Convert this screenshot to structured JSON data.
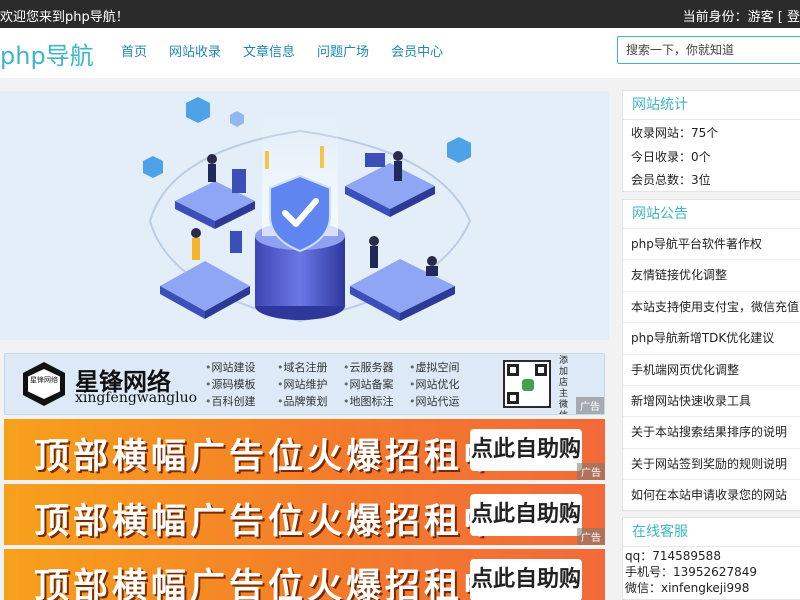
{
  "topbar": {
    "welcome": "欢迎您来到php导航！",
    "identity": "当前身份：游客 [ 登"
  },
  "header": {
    "logo": "php导航",
    "nav": [
      "首页",
      "网站收录",
      "文章信息",
      "问题广场",
      "会员中心"
    ],
    "search_placeholder": "搜索一下，你就知道"
  },
  "banner": {
    "slide_count": 2,
    "active_slide": 0
  },
  "ads": {
    "brand": {
      "name": "星锋网络",
      "pinyin": "xingfengwangluo",
      "badge": "星锋网络",
      "services": [
        "网站建设",
        "域名注册",
        "云服务器",
        "虚拟空间",
        "源码模板",
        "网站维护",
        "网站备案",
        "网站优化",
        "百科创建",
        "品牌策划",
        "地图标注",
        "网站代运"
      ],
      "add_wechat": "添加店主微信",
      "tag": "广告"
    },
    "banners": [
      {
        "slogan": "顶部横幅广告位火爆招租中……",
        "cta": "点此自助购买",
        "tag": "广告"
      },
      {
        "slogan": "顶部横幅广告位火爆招租中……",
        "cta": "点此自助购买",
        "tag": "广告"
      },
      {
        "slogan": "顶部横幅广告位火爆招租中……",
        "cta": "点此自助购买",
        "tag": "广告"
      }
    ]
  },
  "stats": {
    "title": "网站统计",
    "lines": [
      "收录网站：75个",
      "今日收录：0个",
      "会员总数：3位"
    ]
  },
  "notice": {
    "title": "网站公告",
    "items": [
      "php导航平台软件著作权",
      "友情链接优化调整",
      "本站支持使用支付宝，微信充值",
      "php导航新增TDK优化建议",
      "手机端网页优化调整",
      "新增网站快速收录工具",
      "关于本站搜索结果排序的说明",
      "关于网站签到奖励的规则说明",
      "如何在本站申请收录您的网站"
    ]
  },
  "service": {
    "title": "在线客服",
    "lines": [
      "qq：714589588",
      "手机号：13952627849",
      "微信：xinfengkeji998"
    ]
  },
  "colors": {
    "accent": "#3eb6c6",
    "nav_link": "#1e88b4",
    "topbar": "#2b2b2b",
    "ad_orange": "#f47b2a"
  }
}
